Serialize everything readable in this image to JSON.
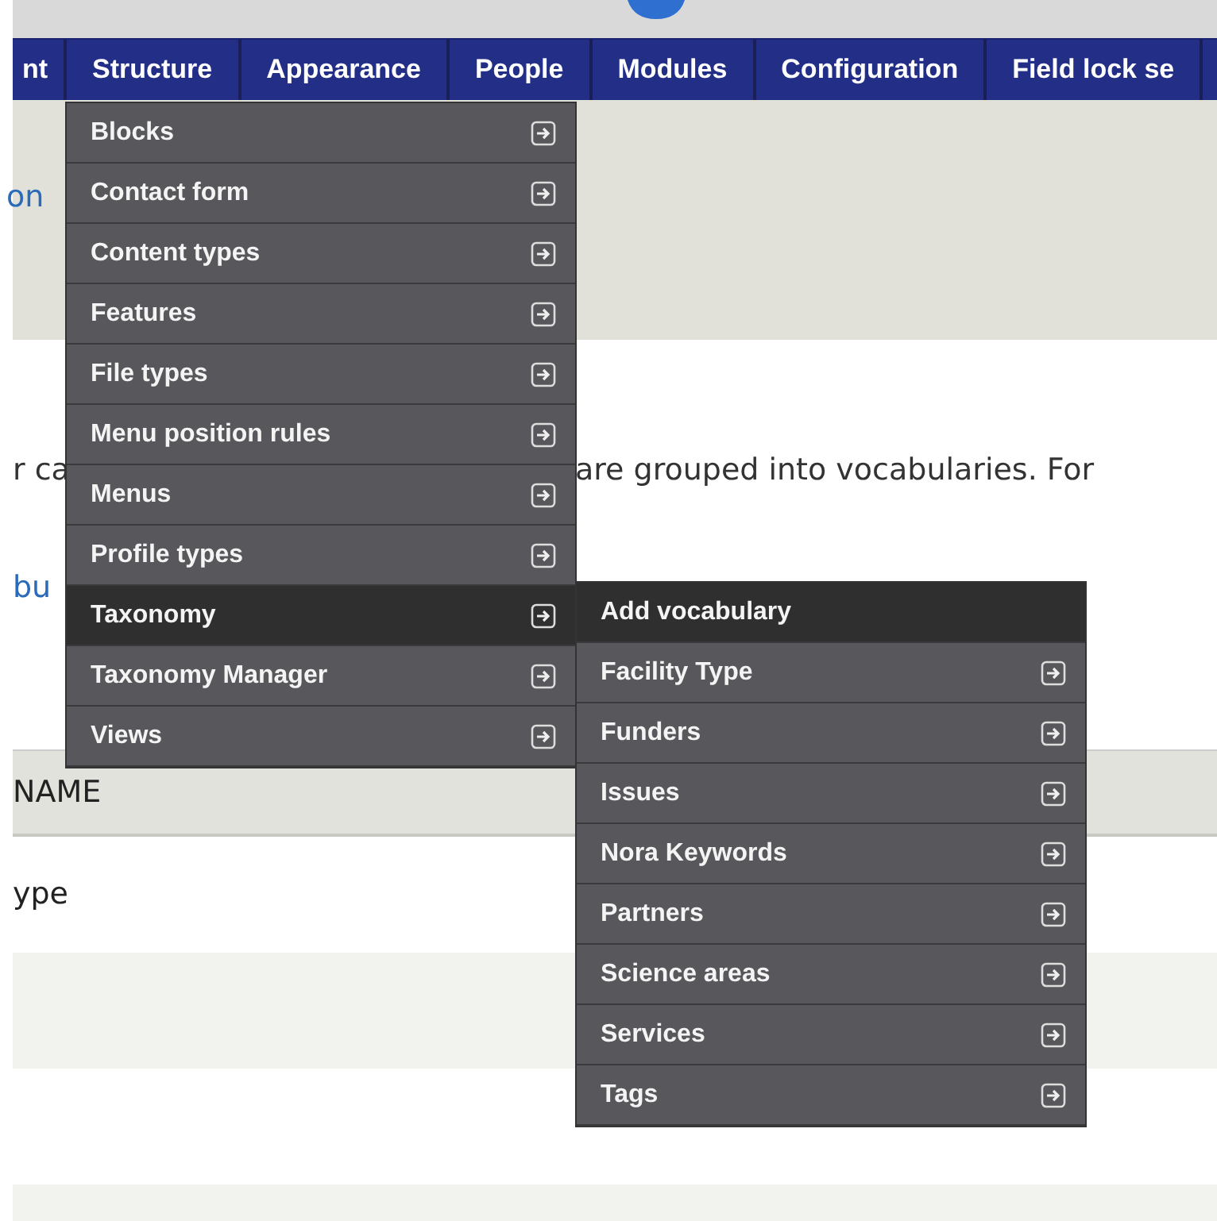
{
  "nav_tabs": [
    {
      "label": "nt"
    },
    {
      "label": "Structure"
    },
    {
      "label": "Appearance"
    },
    {
      "label": "People"
    },
    {
      "label": "Modules"
    },
    {
      "label": "Configuration"
    },
    {
      "label": "Field lock se"
    }
  ],
  "breadcrumb": "on",
  "description": {
    "left": "r ca",
    "right": "are grouped into vocabularies. For"
  },
  "add_link": "bu",
  "table": {
    "header": "NAME",
    "rows": [
      "ype"
    ]
  },
  "structure_menu": [
    {
      "label": "Blocks",
      "submenu": true,
      "selected": false
    },
    {
      "label": "Contact form",
      "submenu": true,
      "selected": false
    },
    {
      "label": "Content types",
      "submenu": true,
      "selected": false
    },
    {
      "label": "Features",
      "submenu": true,
      "selected": false
    },
    {
      "label": "File types",
      "submenu": true,
      "selected": false
    },
    {
      "label": "Menu position rules",
      "submenu": true,
      "selected": false
    },
    {
      "label": "Menus",
      "submenu": true,
      "selected": false
    },
    {
      "label": "Profile types",
      "submenu": true,
      "selected": false
    },
    {
      "label": "Taxonomy",
      "submenu": true,
      "selected": true
    },
    {
      "label": "Taxonomy Manager",
      "submenu": true,
      "selected": false
    },
    {
      "label": "Views",
      "submenu": true,
      "selected": false
    }
  ],
  "taxonomy_menu": [
    {
      "label": "Add vocabulary",
      "submenu": false,
      "selected": true
    },
    {
      "label": "Facility Type",
      "submenu": true,
      "selected": false
    },
    {
      "label": "Funders",
      "submenu": true,
      "selected": false
    },
    {
      "label": "Issues",
      "submenu": true,
      "selected": false
    },
    {
      "label": "Nora Keywords",
      "submenu": true,
      "selected": false
    },
    {
      "label": "Partners",
      "submenu": true,
      "selected": false
    },
    {
      "label": "Science areas",
      "submenu": true,
      "selected": false
    },
    {
      "label": "Services",
      "submenu": true,
      "selected": false
    },
    {
      "label": "Tags",
      "submenu": true,
      "selected": false
    }
  ]
}
